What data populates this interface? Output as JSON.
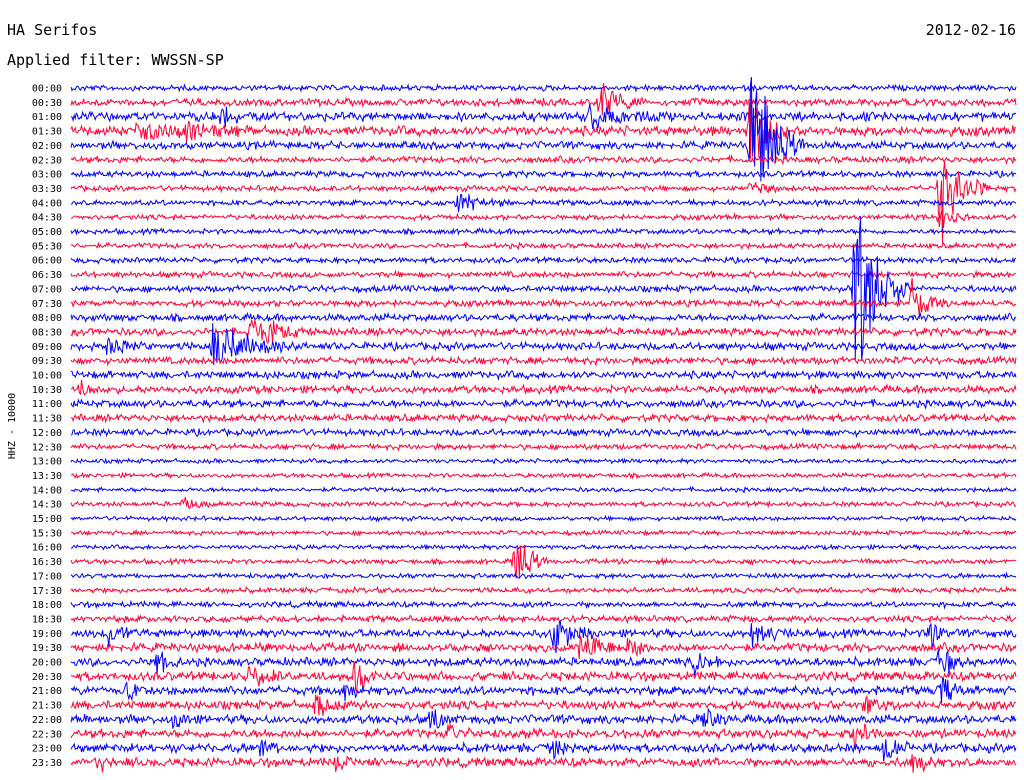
{
  "header": {
    "station": "HA Serifos",
    "filter_text": "Applied filter: WWSSN-SP",
    "date": "2012-02-16"
  },
  "colors": {
    "trace_a": "#0000ff",
    "trace_b": "#ff0033",
    "background": "#ffffff",
    "text": "#000000"
  },
  "chart_data": {
    "type": "line",
    "title": "",
    "ylabel": "HHZ - 10000",
    "xlabel": "",
    "rows": [
      "00:00",
      "00:30",
      "01:00",
      "01:30",
      "02:00",
      "02:30",
      "03:00",
      "03:30",
      "04:00",
      "04:30",
      "05:00",
      "05:30",
      "06:00",
      "06:30",
      "07:00",
      "07:30",
      "08:00",
      "08:30",
      "09:00",
      "09:30",
      "10:00",
      "10:30",
      "11:00",
      "11:30",
      "12:00",
      "12:30",
      "13:00",
      "13:30",
      "14:00",
      "14:30",
      "15:00",
      "15:30",
      "16:00",
      "16:30",
      "17:00",
      "17:30",
      "18:00",
      "18:30",
      "19:00",
      "19:30",
      "20:00",
      "20:30",
      "21:00",
      "21:30",
      "22:00",
      "22:30",
      "23:00",
      "23:30"
    ],
    "row_colors": [
      "blue",
      "red"
    ],
    "noise_level": [
      0.35,
      0.55,
      0.75,
      0.85,
      0.6,
      0.45,
      0.4,
      0.35,
      0.35,
      0.3,
      0.3,
      0.3,
      0.35,
      0.4,
      0.45,
      0.45,
      0.55,
      0.6,
      0.6,
      0.55,
      0.6,
      0.6,
      0.6,
      0.55,
      0.5,
      0.35,
      0.2,
      0.2,
      0.2,
      0.25,
      0.2,
      0.2,
      0.2,
      0.25,
      0.25,
      0.3,
      0.35,
      0.45,
      0.65,
      0.7,
      0.7,
      0.75,
      0.75,
      0.75,
      0.75,
      0.75,
      0.75,
      0.75
    ],
    "events": [
      {
        "row": 1,
        "t": 0.56,
        "amp": 25,
        "dur": 0.05
      },
      {
        "row": 2,
        "t": 0.55,
        "amp": 18,
        "dur": 0.07
      },
      {
        "row": 2,
        "t": 0.16,
        "amp": 10,
        "dur": 0.04
      },
      {
        "row": 3,
        "t": 0.07,
        "amp": 10,
        "dur": 0.12
      },
      {
        "row": 3,
        "t": 0.12,
        "amp": 11,
        "dur": 0.05
      },
      {
        "row": 3,
        "t": 0.72,
        "amp": 60,
        "dur": 0.04
      },
      {
        "row": 4,
        "t": 0.72,
        "amp": 100,
        "dur": 0.06
      },
      {
        "row": 7,
        "t": 0.92,
        "amp": 70,
        "dur": 0.05
      },
      {
        "row": 7,
        "t": 0.72,
        "amp": 10,
        "dur": 0.03
      },
      {
        "row": 8,
        "t": 0.41,
        "amp": 14,
        "dur": 0.05
      },
      {
        "row": 9,
        "t": 0.92,
        "amp": 20,
        "dur": 0.03
      },
      {
        "row": 14,
        "t": 0.83,
        "amp": 130,
        "dur": 0.06
      },
      {
        "row": 15,
        "t": 0.89,
        "amp": 35,
        "dur": 0.04
      },
      {
        "row": 17,
        "t": 0.19,
        "amp": 22,
        "dur": 0.07
      },
      {
        "row": 18,
        "t": 0.04,
        "amp": 12,
        "dur": 0.05
      },
      {
        "row": 18,
        "t": 0.15,
        "amp": 30,
        "dur": 0.1
      },
      {
        "row": 21,
        "t": 0.01,
        "amp": 8,
        "dur": 0.03
      },
      {
        "row": 29,
        "t": 0.12,
        "amp": 8,
        "dur": 0.03
      },
      {
        "row": 33,
        "t": 0.47,
        "amp": 40,
        "dur": 0.04
      },
      {
        "row": 38,
        "t": 0.04,
        "amp": 14,
        "dur": 0.04
      },
      {
        "row": 38,
        "t": 0.51,
        "amp": 24,
        "dur": 0.05
      },
      {
        "row": 38,
        "t": 0.72,
        "amp": 16,
        "dur": 0.05
      },
      {
        "row": 38,
        "t": 0.91,
        "amp": 20,
        "dur": 0.02
      },
      {
        "row": 39,
        "t": 0.54,
        "amp": 22,
        "dur": 0.05
      },
      {
        "row": 39,
        "t": 0.59,
        "amp": 14,
        "dur": 0.03
      },
      {
        "row": 40,
        "t": 0.09,
        "amp": 16,
        "dur": 0.03
      },
      {
        "row": 40,
        "t": 0.66,
        "amp": 16,
        "dur": 0.03
      },
      {
        "row": 40,
        "t": 0.92,
        "amp": 20,
        "dur": 0.03
      },
      {
        "row": 41,
        "t": 0.19,
        "amp": 16,
        "dur": 0.04
      },
      {
        "row": 41,
        "t": 0.3,
        "amp": 22,
        "dur": 0.03
      },
      {
        "row": 42,
        "t": 0.06,
        "amp": 10,
        "dur": 0.02
      },
      {
        "row": 42,
        "t": 0.29,
        "amp": 14,
        "dur": 0.02
      },
      {
        "row": 42,
        "t": 0.92,
        "amp": 18,
        "dur": 0.03
      },
      {
        "row": 43,
        "t": 0.26,
        "amp": 14,
        "dur": 0.03
      },
      {
        "row": 43,
        "t": 0.84,
        "amp": 12,
        "dur": 0.03
      },
      {
        "row": 44,
        "t": 0.11,
        "amp": 12,
        "dur": 0.02
      },
      {
        "row": 44,
        "t": 0.38,
        "amp": 16,
        "dur": 0.03
      },
      {
        "row": 44,
        "t": 0.67,
        "amp": 12,
        "dur": 0.03
      },
      {
        "row": 45,
        "t": 0.4,
        "amp": 14,
        "dur": 0.03
      },
      {
        "row": 45,
        "t": 0.83,
        "amp": 16,
        "dur": 0.03
      },
      {
        "row": 46,
        "t": 0.2,
        "amp": 14,
        "dur": 0.02
      },
      {
        "row": 46,
        "t": 0.51,
        "amp": 16,
        "dur": 0.02
      },
      {
        "row": 46,
        "t": 0.86,
        "amp": 18,
        "dur": 0.03
      },
      {
        "row": 47,
        "t": 0.03,
        "amp": 10,
        "dur": 0.02
      },
      {
        "row": 47,
        "t": 0.28,
        "amp": 10,
        "dur": 0.02
      },
      {
        "row": 47,
        "t": 0.89,
        "amp": 16,
        "dur": 0.03
      }
    ]
  }
}
